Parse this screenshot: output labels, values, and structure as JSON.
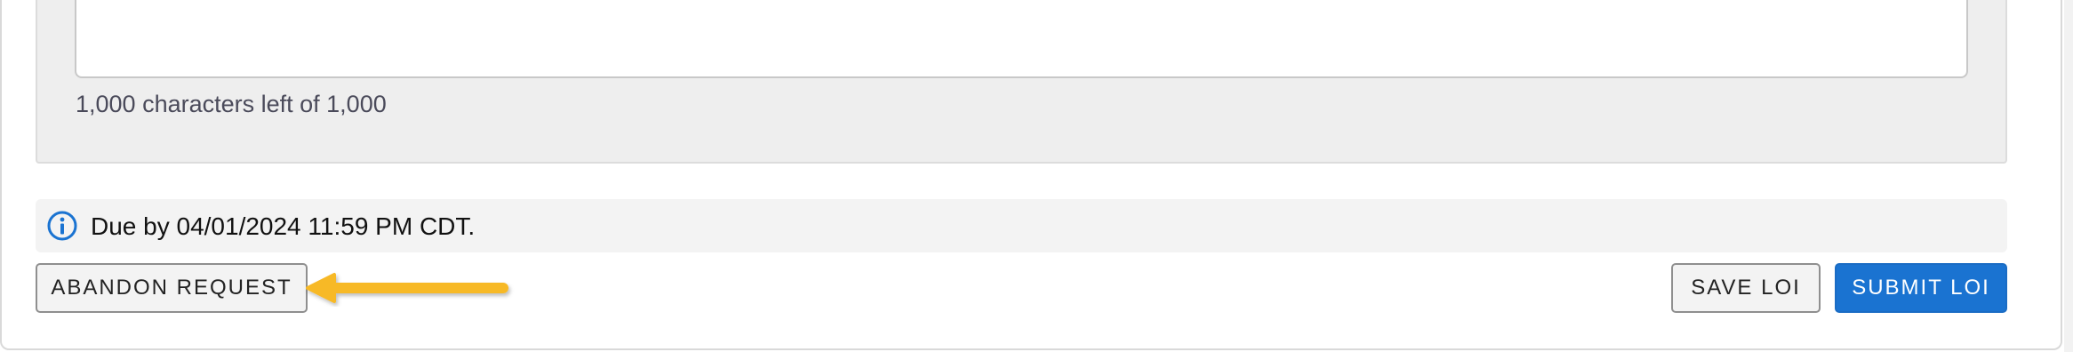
{
  "comment_box": {
    "value": "",
    "char_count_text": "1,000 characters left of 1,000"
  },
  "info": {
    "icon": "info-circle-icon",
    "text": "Due by 04/01/2024 11:59 PM CDT."
  },
  "actions": {
    "abandon_label": "ABANDON REQUEST",
    "save_label": "SAVE LOI",
    "submit_label": "SUBMIT LOI"
  },
  "annotation": {
    "icon": "left-arrow-icon",
    "color": "#F7B928"
  },
  "colors": {
    "primary": "#1A73D1",
    "info_icon": "#1A73D1",
    "panel_bg": "#EEEEEE"
  }
}
